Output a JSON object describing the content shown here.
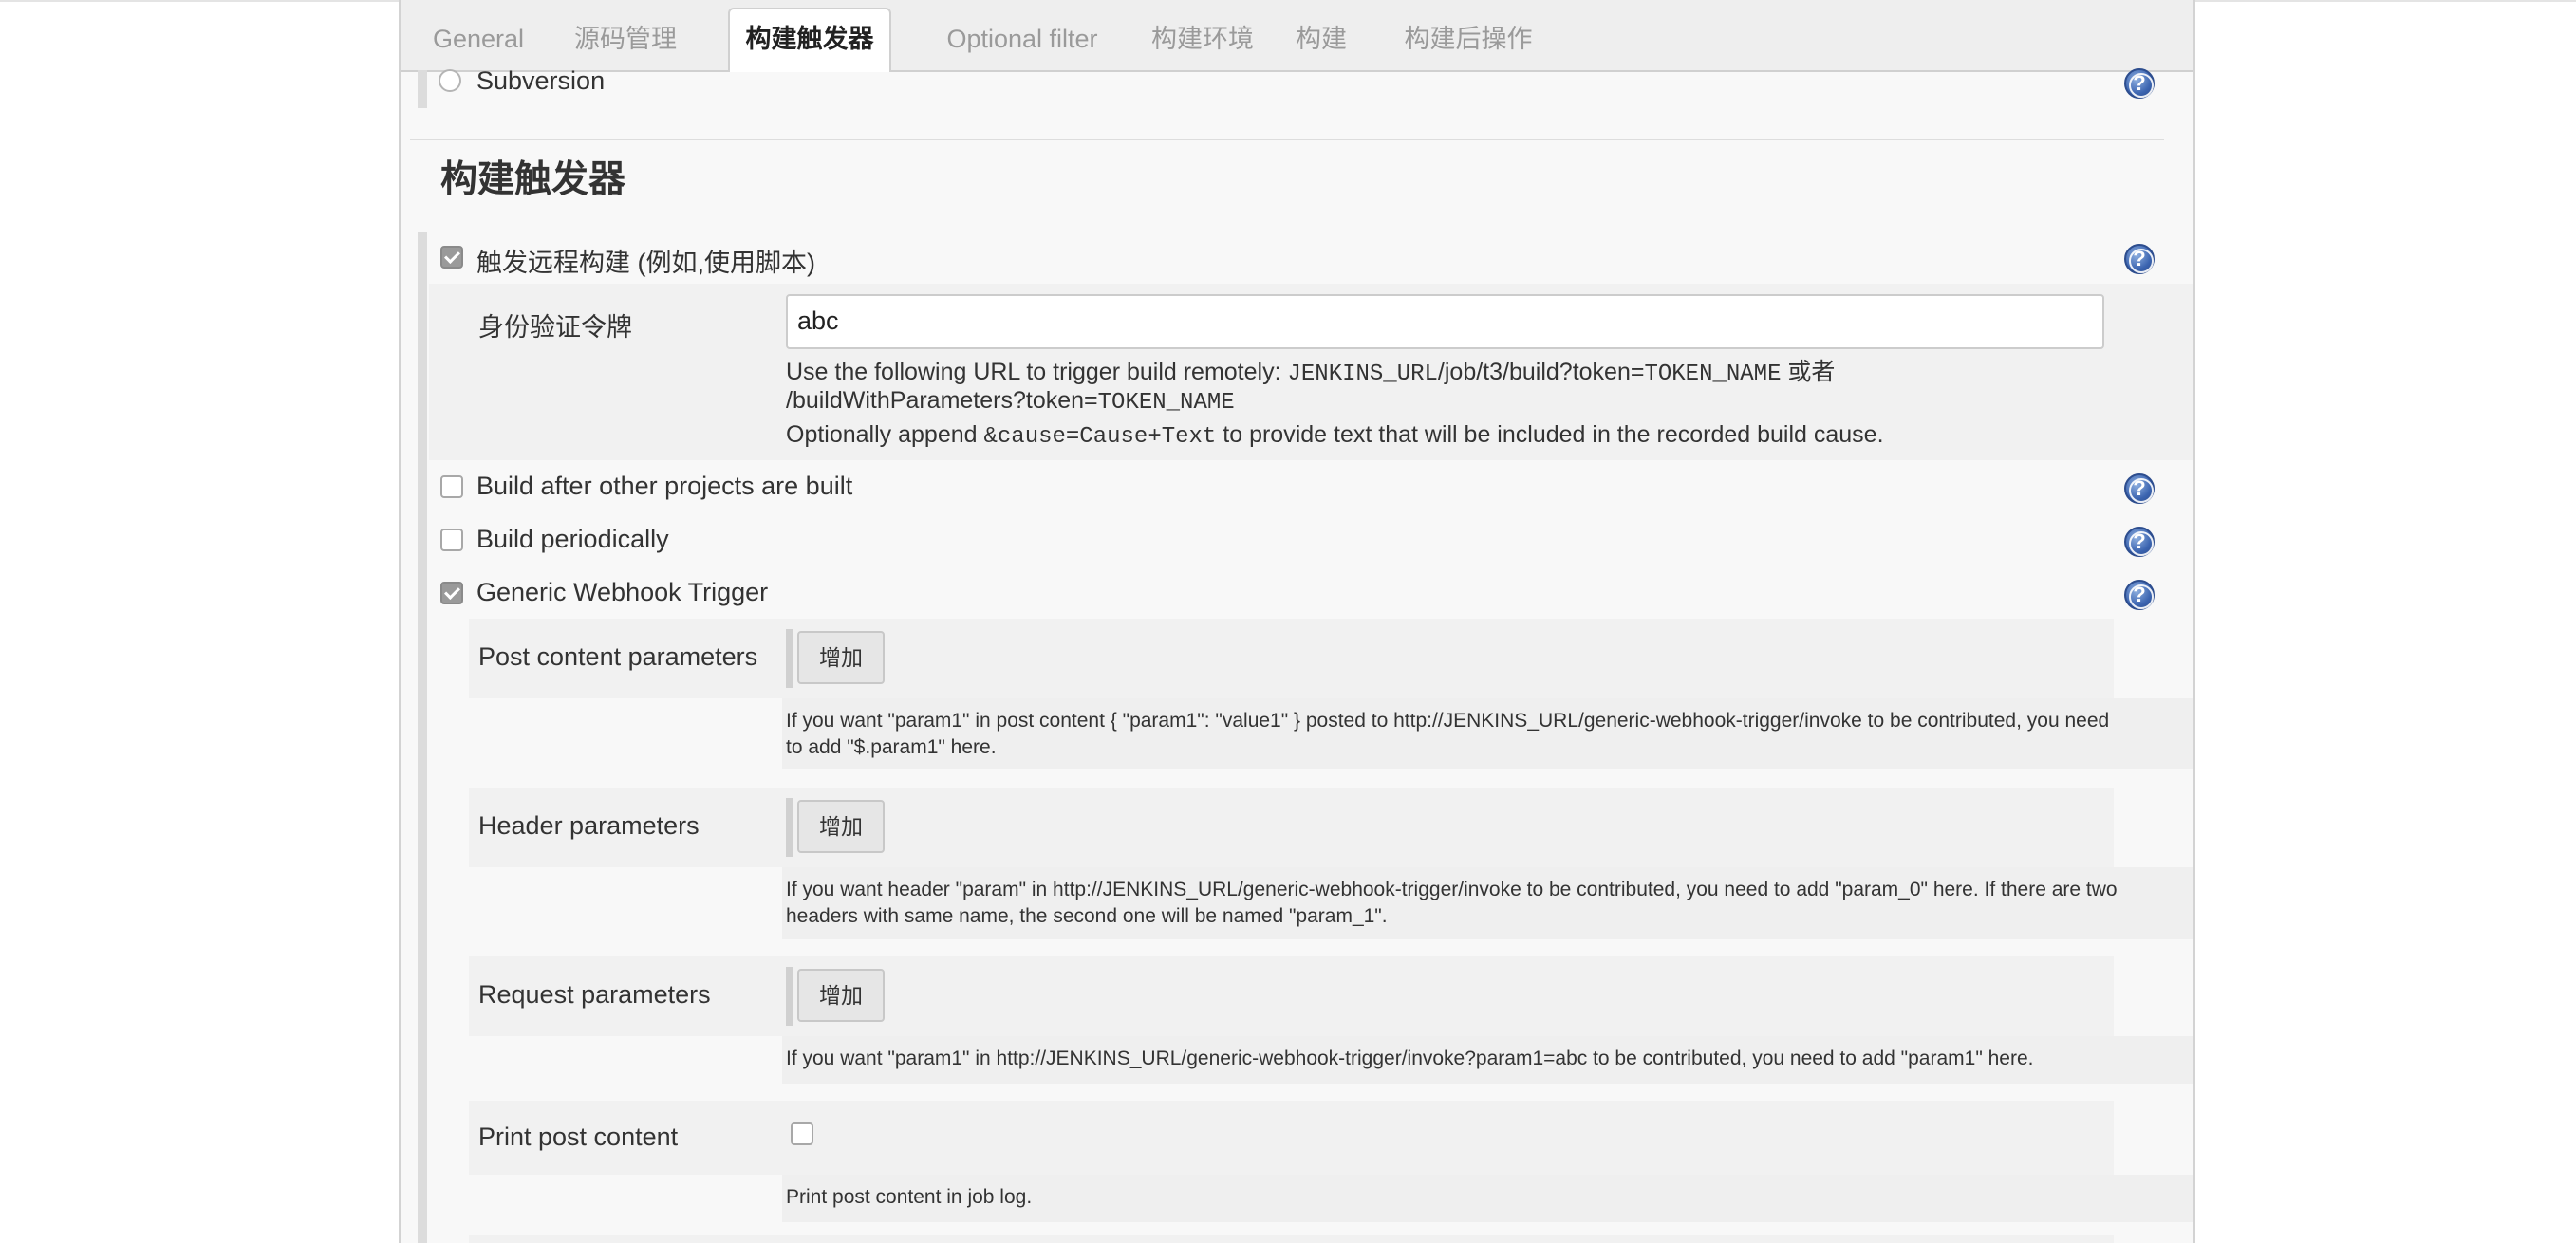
{
  "tabs": [
    {
      "label": "General"
    },
    {
      "label": "源码管理"
    },
    {
      "label": "构建触发器"
    },
    {
      "label": "Optional filter"
    },
    {
      "label": "构建环境"
    },
    {
      "label": "构建"
    },
    {
      "label": "构建后操作"
    }
  ],
  "scm": {
    "subversion_label": "Subversion"
  },
  "section": {
    "title": "构建触发器"
  },
  "remote_trigger": {
    "label": "触发远程构建 (例如,使用脚本)",
    "checked": true,
    "token_label": "身份验证令牌",
    "token_value": "abc",
    "help_line1_a": "Use the following URL to trigger build remotely: ",
    "help_line1_code1": "JENKINS_URL",
    "help_line1_b": "/job/t3/build?token=",
    "help_line1_code2": "TOKEN_NAME",
    "help_line1_c": " 或者",
    "help_line2_a": "/buildWithParameters?token=",
    "help_line2_code": "TOKEN_NAME",
    "help_line3_a": "Optionally append ",
    "help_line3_code": "&cause=Cause+Text",
    "help_line3_b": " to provide text that will be included in the recorded build cause."
  },
  "build_after": {
    "label": "Build after other projects are built",
    "checked": false
  },
  "build_periodically": {
    "label": "Build periodically",
    "checked": false
  },
  "generic_webhook": {
    "label": "Generic Webhook Trigger",
    "checked": true
  },
  "post_content": {
    "label": "Post content parameters",
    "add_button": "增加",
    "help_line1": "If you want \"param1\" in post content { \"param1\": \"value1\" } posted to http://JENKINS_URL/generic-webhook-trigger/invoke to be contributed, you need",
    "help_line2": "to add \"$.param1\" here."
  },
  "header_params": {
    "label": "Header parameters",
    "add_button": "增加",
    "help_line1": "If you want header \"param\" in http://JENKINS_URL/generic-webhook-trigger/invoke to be contributed, you need to add \"param_0\" here. If there are two",
    "help_line2": "headers with same name, the second one will be named \"param_1\"."
  },
  "request_params": {
    "label": "Request parameters",
    "add_button": "增加",
    "help_line1": "If you want \"param1\" in http://JENKINS_URL/generic-webhook-trigger/invoke?param1=abc to be contributed, you need to add \"param1\" here."
  },
  "print_post": {
    "label": "Print post content",
    "checked": false,
    "help_line1": "Print post content in job log."
  },
  "help_glyph": "?"
}
